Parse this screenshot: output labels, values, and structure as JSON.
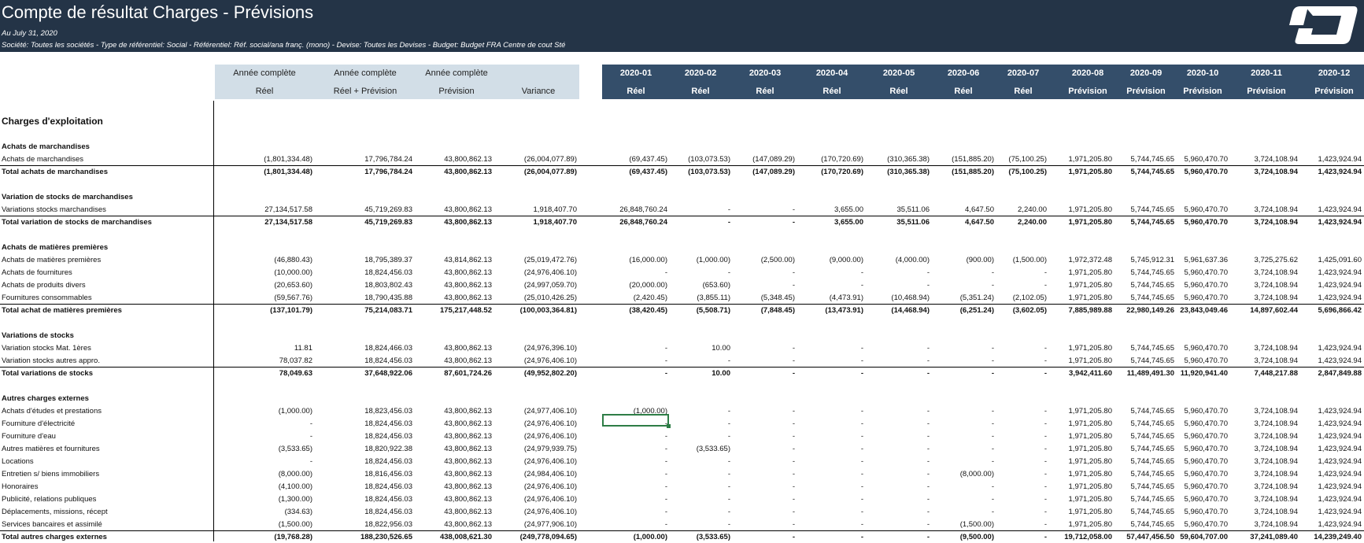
{
  "report": {
    "title": "Compte de résultat Charges - Prévisions",
    "date": "Au July 31, 2020",
    "filters": "Société: Toutes les sociétés  - Type de référentiel: Social  - Référentiel: Réf. social/ana franç. (mono) - Devise: Toutes les Devises - Budget: Budget FRA Centre de cout Sté"
  },
  "logo_icon": "company-logo-icon",
  "colors": {
    "banner": "#243447",
    "header_left": "#d2dee7",
    "header_right": "#344e6a",
    "selection": "#2e7d46"
  },
  "headers": {
    "left_top": [
      "Année complète",
      "Année complète",
      "Année complète",
      ""
    ],
    "left_bottom": [
      "Réel",
      "Réel + Prévision",
      "Prévision",
      "Variance"
    ],
    "months": [
      "2020-01",
      "2020-02",
      "2020-03",
      "2020-04",
      "2020-05",
      "2020-06",
      "2020-07",
      "2020-08",
      "2020-09",
      "2020-10",
      "2020-11",
      "2020-12"
    ],
    "month_types": [
      "Réel",
      "Réel",
      "Réel",
      "Réel",
      "Réel",
      "Réel",
      "Réel",
      "Prévision",
      "Prévision",
      "Prévision",
      "Prévision",
      "Prévision"
    ]
  },
  "rows": [
    {
      "kind": "main",
      "label": "Charges d'exploitation",
      "values": []
    },
    {
      "kind": "blank",
      "label": "",
      "values": []
    },
    {
      "kind": "section",
      "label": "Achats de marchandises",
      "values": []
    },
    {
      "kind": "line",
      "label": "Achats de marchandises",
      "values": [
        "(1,801,334.48)",
        "17,796,784.24",
        "43,800,862.13",
        "(26,004,077.89)",
        "(69,437.45)",
        "(103,073.53)",
        "(147,089.29)",
        "(170,720.69)",
        "(310,365.38)",
        "(151,885.20)",
        "(75,100.25)",
        "1,971,205.80",
        "5,744,745.65",
        "5,960,470.70",
        "3,724,108.94",
        "1,423,924.94"
      ]
    },
    {
      "kind": "total",
      "label": "Total achats de marchandises",
      "values": [
        "(1,801,334.48)",
        "17,796,784.24",
        "43,800,862.13",
        "(26,004,077.89)",
        "(69,437.45)",
        "(103,073.53)",
        "(147,089.29)",
        "(170,720.69)",
        "(310,365.38)",
        "(151,885.20)",
        "(75,100.25)",
        "1,971,205.80",
        "5,744,745.65",
        "5,960,470.70",
        "3,724,108.94",
        "1,423,924.94"
      ]
    },
    {
      "kind": "blank",
      "label": "",
      "values": []
    },
    {
      "kind": "section",
      "label": "Variation de stocks de marchandises",
      "values": []
    },
    {
      "kind": "line",
      "label": "Variations stocks marchandises",
      "values": [
        "27,134,517.58",
        "45,719,269.83",
        "43,800,862.13",
        "1,918,407.70",
        "26,848,760.24",
        "-",
        "-",
        "3,655.00",
        "35,511.06",
        "4,647.50",
        "2,240.00",
        "1,971,205.80",
        "5,744,745.65",
        "5,960,470.70",
        "3,724,108.94",
        "1,423,924.94"
      ]
    },
    {
      "kind": "total",
      "label": "Total variation de stocks de marchandises",
      "values": [
        "27,134,517.58",
        "45,719,269.83",
        "43,800,862.13",
        "1,918,407.70",
        "26,848,760.24",
        "-",
        "-",
        "3,655.00",
        "35,511.06",
        "4,647.50",
        "2,240.00",
        "1,971,205.80",
        "5,744,745.65",
        "5,960,470.70",
        "3,724,108.94",
        "1,423,924.94"
      ]
    },
    {
      "kind": "blank",
      "label": "",
      "values": []
    },
    {
      "kind": "section",
      "label": "Achats de matières premières",
      "values": []
    },
    {
      "kind": "line",
      "label": "Achats de matières premières",
      "values": [
        "(46,880.43)",
        "18,795,389.37",
        "43,814,862.13",
        "(25,019,472.76)",
        "(16,000.00)",
        "(1,000.00)",
        "(2,500.00)",
        "(9,000.00)",
        "(4,000.00)",
        "(900.00)",
        "(1,500.00)",
        "1,972,372.48",
        "5,745,912.31",
        "5,961,637.36",
        "3,725,275.62",
        "1,425,091.60"
      ]
    },
    {
      "kind": "line",
      "label": "Achats de fournitures",
      "values": [
        "(10,000.00)",
        "18,824,456.03",
        "43,800,862.13",
        "(24,976,406.10)",
        "-",
        "-",
        "-",
        "-",
        "-",
        "-",
        "-",
        "1,971,205.80",
        "5,744,745.65",
        "5,960,470.70",
        "3,724,108.94",
        "1,423,924.94"
      ]
    },
    {
      "kind": "line",
      "label": "Achats de produits divers",
      "values": [
        "(20,653.60)",
        "18,803,802.43",
        "43,800,862.13",
        "(24,997,059.70)",
        "(20,000.00)",
        "(653.60)",
        "-",
        "-",
        "-",
        "-",
        "-",
        "1,971,205.80",
        "5,744,745.65",
        "5,960,470.70",
        "3,724,108.94",
        "1,423,924.94"
      ]
    },
    {
      "kind": "line",
      "label": "Fournitures consommables",
      "values": [
        "(59,567.76)",
        "18,790,435.88",
        "43,800,862.13",
        "(25,010,426.25)",
        "(2,420.45)",
        "(3,855.11)",
        "(5,348.45)",
        "(4,473.91)",
        "(10,468.94)",
        "(5,351.24)",
        "(2,102.05)",
        "1,971,205.80",
        "5,744,745.65",
        "5,960,470.70",
        "3,724,108.94",
        "1,423,924.94"
      ]
    },
    {
      "kind": "total",
      "label": "Total achat de matières premières",
      "values": [
        "(137,101.79)",
        "75,214,083.71",
        "175,217,448.52",
        "(100,003,364.81)",
        "(38,420.45)",
        "(5,508.71)",
        "(7,848.45)",
        "(13,473.91)",
        "(14,468.94)",
        "(6,251.24)",
        "(3,602.05)",
        "7,885,989.88",
        "22,980,149.26",
        "23,843,049.46",
        "14,897,602.44",
        "5,696,866.42"
      ]
    },
    {
      "kind": "blank",
      "label": "",
      "values": []
    },
    {
      "kind": "section",
      "label": "Variations de stocks",
      "values": []
    },
    {
      "kind": "line",
      "label": "Variation stocks Mat. 1ères",
      "values": [
        "11.81",
        "18,824,466.03",
        "43,800,862.13",
        "(24,976,396.10)",
        "-",
        "10.00",
        "-",
        "-",
        "-",
        "-",
        "-",
        "1,971,205.80",
        "5,744,745.65",
        "5,960,470.70",
        "3,724,108.94",
        "1,423,924.94"
      ]
    },
    {
      "kind": "line",
      "label": "Variation stocks autres appro.",
      "values": [
        "78,037.82",
        "18,824,456.03",
        "43,800,862.13",
        "(24,976,406.10)",
        "-",
        "-",
        "-",
        "-",
        "-",
        "-",
        "-",
        "1,971,205.80",
        "5,744,745.65",
        "5,960,470.70",
        "3,724,108.94",
        "1,423,924.94"
      ]
    },
    {
      "kind": "total",
      "label": "Total variations de stocks",
      "values": [
        "78,049.63",
        "37,648,922.06",
        "87,601,724.26",
        "(49,952,802.20)",
        "-",
        "10.00",
        "-",
        "-",
        "-",
        "-",
        "-",
        "3,942,411.60",
        "11,489,491.30",
        "11,920,941.40",
        "7,448,217.88",
        "2,847,849.88"
      ]
    },
    {
      "kind": "blank",
      "label": "",
      "values": []
    },
    {
      "kind": "section",
      "label": "Autres charges externes",
      "values": []
    },
    {
      "kind": "line",
      "label": "Achats d'études et prestations",
      "values": [
        "(1,000.00)",
        "18,823,456.03",
        "43,800,862.13",
        "(24,977,406.10)",
        "(1,000.00)",
        "-",
        "-",
        "-",
        "-",
        "-",
        "-",
        "1,971,205.80",
        "5,744,745.65",
        "5,960,470.70",
        "3,724,108.94",
        "1,423,924.94"
      ]
    },
    {
      "kind": "line",
      "label": "Fourniture d'électricité",
      "values": [
        "-",
        "18,824,456.03",
        "43,800,862.13",
        "(24,976,406.10)",
        "-",
        "-",
        "-",
        "-",
        "-",
        "-",
        "-",
        "1,971,205.80",
        "5,744,745.65",
        "5,960,470.70",
        "3,724,108.94",
        "1,423,924.94"
      ]
    },
    {
      "kind": "line",
      "label": "Fourniture d'eau",
      "values": [
        "-",
        "18,824,456.03",
        "43,800,862.13",
        "(24,976,406.10)",
        "-",
        "-",
        "-",
        "-",
        "-",
        "-",
        "-",
        "1,971,205.80",
        "5,744,745.65",
        "5,960,470.70",
        "3,724,108.94",
        "1,423,924.94"
      ]
    },
    {
      "kind": "line",
      "label": "Autres matières et fournitures",
      "values": [
        "(3,533.65)",
        "18,820,922.38",
        "43,800,862.13",
        "(24,979,939.75)",
        "-",
        "(3,533.65)",
        "-",
        "-",
        "-",
        "-",
        "-",
        "1,971,205.80",
        "5,744,745.65",
        "5,960,470.70",
        "3,724,108.94",
        "1,423,924.94"
      ]
    },
    {
      "kind": "line",
      "label": "Locations",
      "values": [
        "-",
        "18,824,456.03",
        "43,800,862.13",
        "(24,976,406.10)",
        "-",
        "-",
        "-",
        "-",
        "-",
        "-",
        "-",
        "1,971,205.80",
        "5,744,745.65",
        "5,960,470.70",
        "3,724,108.94",
        "1,423,924.94"
      ]
    },
    {
      "kind": "line",
      "label": "Entretien s/ biens immobiliers",
      "values": [
        "(8,000.00)",
        "18,816,456.03",
        "43,800,862.13",
        "(24,984,406.10)",
        "-",
        "-",
        "-",
        "-",
        "-",
        "(8,000.00)",
        "-",
        "1,971,205.80",
        "5,744,745.65",
        "5,960,470.70",
        "3,724,108.94",
        "1,423,924.94"
      ]
    },
    {
      "kind": "line",
      "label": "Honoraires",
      "values": [
        "(4,100.00)",
        "18,824,456.03",
        "43,800,862.13",
        "(24,976,406.10)",
        "-",
        "-",
        "-",
        "-",
        "-",
        "-",
        "-",
        "1,971,205.80",
        "5,744,745.65",
        "5,960,470.70",
        "3,724,108.94",
        "1,423,924.94"
      ]
    },
    {
      "kind": "line",
      "label": "Publicité, relations publiques",
      "values": [
        "(1,300.00)",
        "18,824,456.03",
        "43,800,862.13",
        "(24,976,406.10)",
        "-",
        "-",
        "-",
        "-",
        "-",
        "-",
        "-",
        "1,971,205.80",
        "5,744,745.65",
        "5,960,470.70",
        "3,724,108.94",
        "1,423,924.94"
      ]
    },
    {
      "kind": "line",
      "label": "Déplacements, missions, récept",
      "values": [
        "(334.63)",
        "18,824,456.03",
        "43,800,862.13",
        "(24,976,406.10)",
        "-",
        "-",
        "-",
        "-",
        "-",
        "-",
        "-",
        "1,971,205.80",
        "5,744,745.65",
        "5,960,470.70",
        "3,724,108.94",
        "1,423,924.94"
      ]
    },
    {
      "kind": "line",
      "label": "Services bancaires et assimilé",
      "values": [
        "(1,500.00)",
        "18,822,956.03",
        "43,800,862.13",
        "(24,977,906.10)",
        "-",
        "-",
        "-",
        "-",
        "-",
        "(1,500.00)",
        "-",
        "1,971,205.80",
        "5,744,745.65",
        "5,960,470.70",
        "3,724,108.94",
        "1,423,924.94"
      ]
    },
    {
      "kind": "total",
      "label": "Total autres charges externes",
      "values": [
        "(19,768.28)",
        "188,230,526.65",
        "438,008,621.30",
        "(249,778,094.65)",
        "(1,000.00)",
        "(3,533.65)",
        "-",
        "-",
        "-",
        "(9,500.00)",
        "-",
        "19,712,058.00",
        "57,447,456.50",
        "59,604,707.00",
        "37,241,089.40",
        "14,239,249.40"
      ]
    }
  ]
}
